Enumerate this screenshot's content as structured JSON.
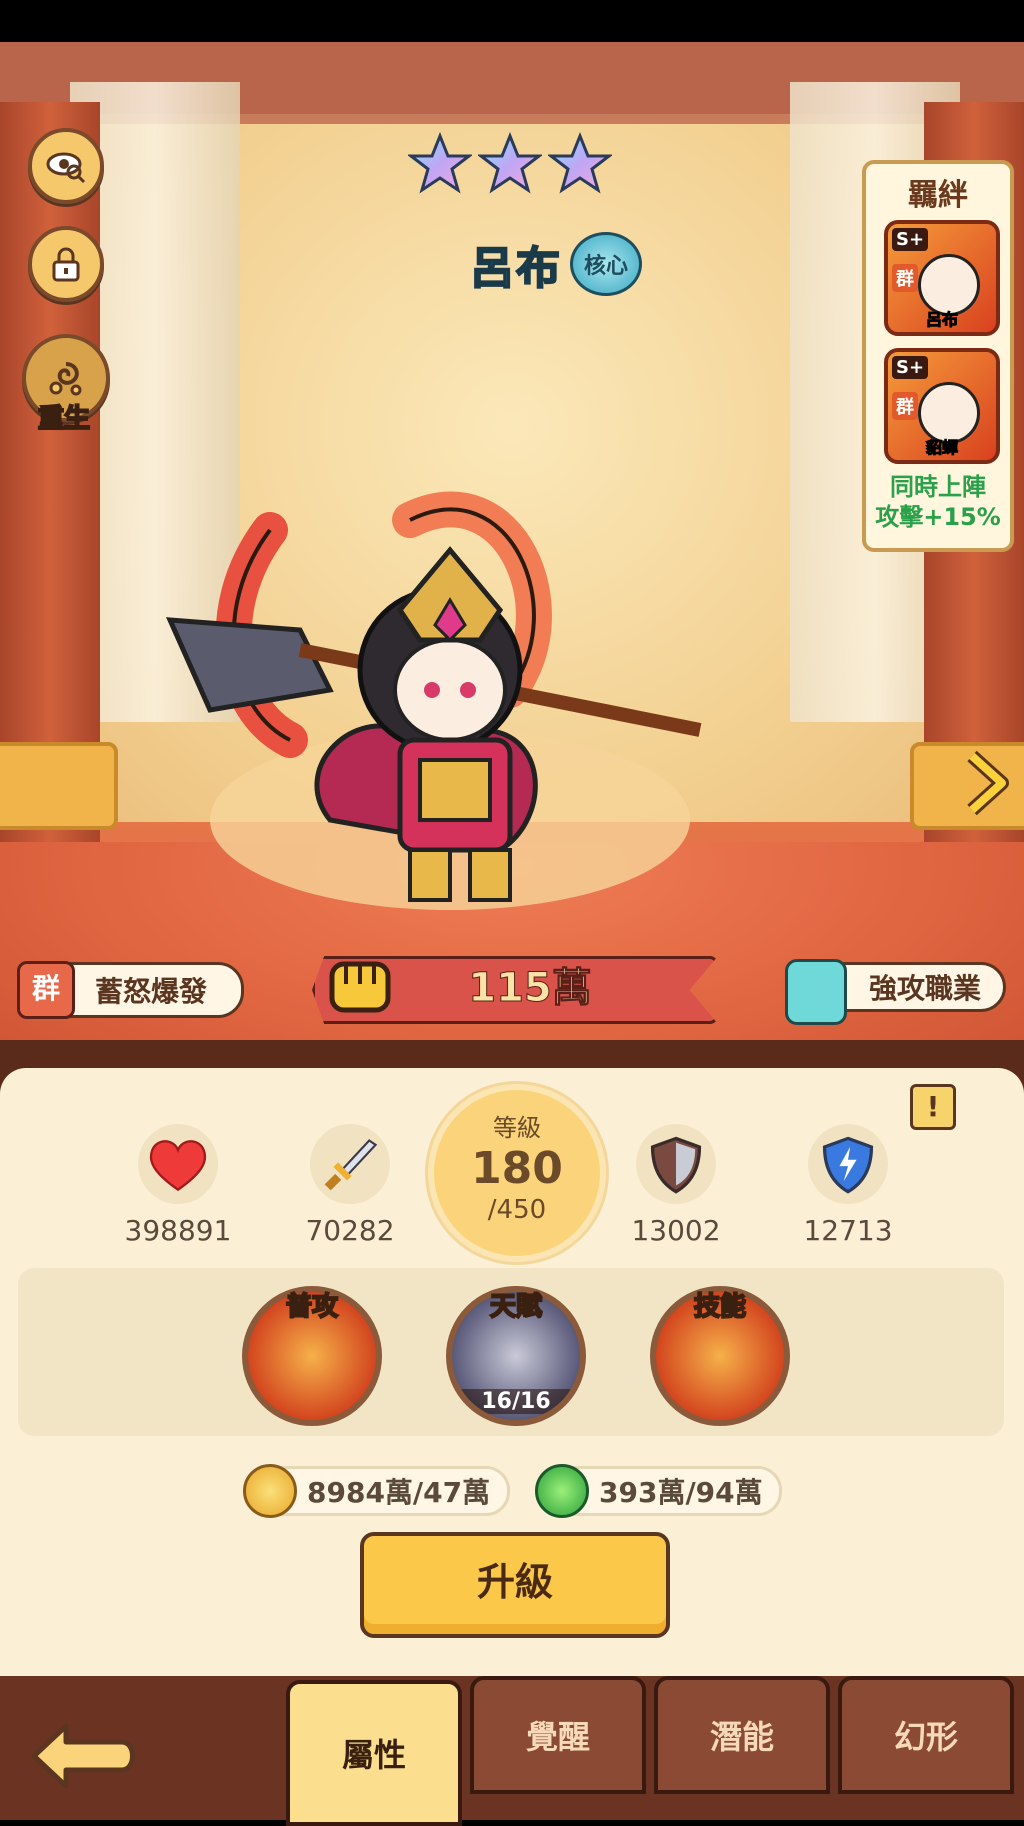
{
  "hero": {
    "name": "呂布",
    "core_badge": "核心",
    "stars": 3,
    "power": "115萬",
    "faction_tag": "群",
    "rage_label": "蓄怒爆發",
    "class_label": "強攻職業"
  },
  "left_buttons": {
    "rebirth_label": "重生"
  },
  "bond": {
    "title": "羈絆",
    "cards": [
      {
        "rank": "S+",
        "faction": "群",
        "name": "呂布"
      },
      {
        "rank": "S+",
        "faction": "群",
        "name": "貂蟬"
      }
    ],
    "effect_line1": "同時上陣",
    "effect_line2": "攻擊+15%"
  },
  "stats": {
    "hp": "398891",
    "attack": "70282",
    "defense": "13002",
    "magic_defense": "12713",
    "level_label": "等級",
    "level": "180",
    "level_max": "/450",
    "warning": "!"
  },
  "skills": [
    {
      "label": "普攻"
    },
    {
      "label": "天賦",
      "count": "16/16"
    },
    {
      "label": "技能"
    }
  ],
  "resources": {
    "gold": "8984萬/47萬",
    "exp": "393萬/94萬"
  },
  "upgrade_label": "升級",
  "nav": {
    "tabs": [
      "屬性",
      "覺醒",
      "潛能",
      "幻形"
    ],
    "active": "屬性"
  },
  "colors": {
    "accent_gold": "#fbc84a",
    "name_cyan": "#1fb0c7",
    "bond_green": "#2aa04a",
    "power_red": "#d9534a"
  }
}
